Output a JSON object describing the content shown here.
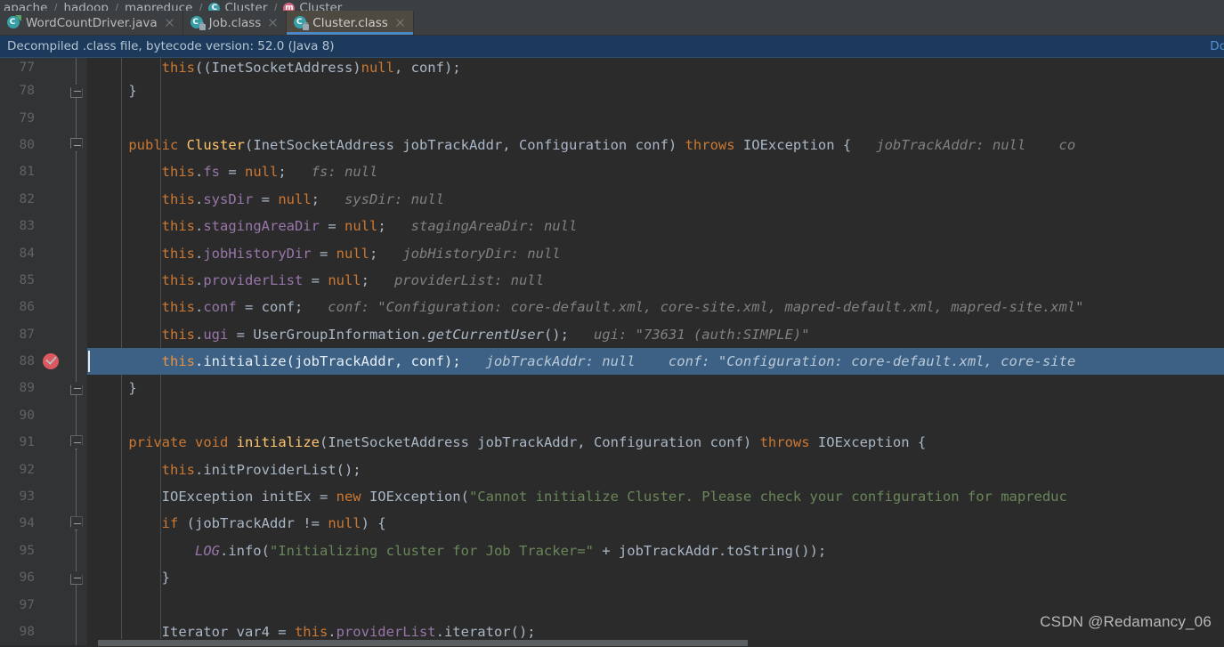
{
  "breadcrumb": {
    "items": [
      {
        "label": "apache",
        "icon": null
      },
      {
        "label": "hadoop",
        "icon": null
      },
      {
        "label": "mapreduce",
        "icon": null
      },
      {
        "label": "Cluster",
        "icon": "class-icon"
      },
      {
        "label": "Cluster",
        "icon": "method-icon"
      }
    ],
    "separator": "/"
  },
  "tabs": [
    {
      "label": "WordCountDriver.java",
      "icon": "java-source-icon",
      "active": false,
      "close": "close-icon"
    },
    {
      "label": "Job.class",
      "icon": "java-class-locked-icon",
      "active": false,
      "close": "close-icon"
    },
    {
      "label": "Cluster.class",
      "icon": "java-class-locked-icon",
      "active": true,
      "close": "close-icon"
    }
  ],
  "notification": {
    "message": "Decompiled .class file, bytecode version: 52.0 (Java 8)",
    "action_label": "Dow"
  },
  "editor": {
    "caret_line": 88,
    "breakpoint_line": 88,
    "lines": [
      {
        "num": "77",
        "clipped": true,
        "fold": null,
        "tokens": [
          {
            "t": "        ",
            "c": "plain"
          },
          {
            "t": "this",
            "c": "kw"
          },
          {
            "t": "((InetSocketAddress)",
            "c": "plain"
          },
          {
            "t": "null",
            "c": "kw"
          },
          {
            "t": ", conf);",
            "c": "plain"
          }
        ]
      },
      {
        "num": "78",
        "fold": "close",
        "tokens": [
          {
            "t": "    ",
            "c": "plain"
          },
          {
            "t": "}",
            "c": "brace"
          }
        ]
      },
      {
        "num": "79",
        "fold": null,
        "tokens": []
      },
      {
        "num": "80",
        "fold": "open",
        "tokens": [
          {
            "t": "    ",
            "c": "plain"
          },
          {
            "t": "public",
            "c": "kw"
          },
          {
            "t": " ",
            "c": "plain"
          },
          {
            "t": "Cluster",
            "c": "mdecl"
          },
          {
            "t": "(InetSocketAddress jobTrackAddr, Configuration conf) ",
            "c": "plain"
          },
          {
            "t": "throws",
            "c": "kw"
          },
          {
            "t": " IOException {",
            "c": "plain"
          },
          {
            "t": "   jobTrackAddr: null",
            "c": "hintv"
          },
          {
            "t": "    co",
            "c": "hintv"
          }
        ]
      },
      {
        "num": "81",
        "fold": null,
        "tokens": [
          {
            "t": "        ",
            "c": "plain"
          },
          {
            "t": "this",
            "c": "kw"
          },
          {
            "t": ".",
            "c": "plain"
          },
          {
            "t": "fs",
            "c": "fld"
          },
          {
            "t": " = ",
            "c": "plain"
          },
          {
            "t": "null",
            "c": "kw"
          },
          {
            "t": ";",
            "c": "plain"
          },
          {
            "t": "   fs: null",
            "c": "hintv"
          }
        ]
      },
      {
        "num": "82",
        "fold": null,
        "tokens": [
          {
            "t": "        ",
            "c": "plain"
          },
          {
            "t": "this",
            "c": "kw"
          },
          {
            "t": ".",
            "c": "plain"
          },
          {
            "t": "sysDir",
            "c": "fld"
          },
          {
            "t": " = ",
            "c": "plain"
          },
          {
            "t": "null",
            "c": "kw"
          },
          {
            "t": ";",
            "c": "plain"
          },
          {
            "t": "   sysDir: null",
            "c": "hintv"
          }
        ]
      },
      {
        "num": "83",
        "fold": null,
        "tokens": [
          {
            "t": "        ",
            "c": "plain"
          },
          {
            "t": "this",
            "c": "kw"
          },
          {
            "t": ".",
            "c": "plain"
          },
          {
            "t": "stagingAreaDir",
            "c": "fld"
          },
          {
            "t": " = ",
            "c": "plain"
          },
          {
            "t": "null",
            "c": "kw"
          },
          {
            "t": ";",
            "c": "plain"
          },
          {
            "t": "   stagingAreaDir: null",
            "c": "hintv"
          }
        ]
      },
      {
        "num": "84",
        "fold": null,
        "tokens": [
          {
            "t": "        ",
            "c": "plain"
          },
          {
            "t": "this",
            "c": "kw"
          },
          {
            "t": ".",
            "c": "plain"
          },
          {
            "t": "jobHistoryDir",
            "c": "fld"
          },
          {
            "t": " = ",
            "c": "plain"
          },
          {
            "t": "null",
            "c": "kw"
          },
          {
            "t": ";",
            "c": "plain"
          },
          {
            "t": "   jobHistoryDir: null",
            "c": "hintv"
          }
        ]
      },
      {
        "num": "85",
        "fold": null,
        "tokens": [
          {
            "t": "        ",
            "c": "plain"
          },
          {
            "t": "this",
            "c": "kw"
          },
          {
            "t": ".",
            "c": "plain"
          },
          {
            "t": "providerList",
            "c": "fld"
          },
          {
            "t": " = ",
            "c": "plain"
          },
          {
            "t": "null",
            "c": "kw"
          },
          {
            "t": ";",
            "c": "plain"
          },
          {
            "t": "   providerList: null",
            "c": "hintv"
          }
        ]
      },
      {
        "num": "86",
        "fold": null,
        "tokens": [
          {
            "t": "        ",
            "c": "plain"
          },
          {
            "t": "this",
            "c": "kw"
          },
          {
            "t": ".",
            "c": "plain"
          },
          {
            "t": "conf",
            "c": "fld"
          },
          {
            "t": " = conf;",
            "c": "plain"
          },
          {
            "t": "   conf: \"Configuration: core-default.xml, core-site.xml, mapred-default.xml, mapred-site.xml\"",
            "c": "hintv"
          }
        ]
      },
      {
        "num": "87",
        "fold": null,
        "tokens": [
          {
            "t": "        ",
            "c": "plain"
          },
          {
            "t": "this",
            "c": "kw"
          },
          {
            "t": ".",
            "c": "plain"
          },
          {
            "t": "ugi",
            "c": "fld"
          },
          {
            "t": " = UserGroupInformation.",
            "c": "plain"
          },
          {
            "t": "getCurrentUser",
            "c": "mcall"
          },
          {
            "t": "();",
            "c": "plain"
          },
          {
            "t": "   ugi: \"73631 (auth:SIMPLE)\"",
            "c": "hintv"
          }
        ]
      },
      {
        "num": "88",
        "fold": null,
        "highlight": true,
        "breakpoint": true,
        "caret": true,
        "tokens": [
          {
            "t": "        ",
            "c": "plain"
          },
          {
            "t": "this",
            "c": "kw"
          },
          {
            "t": ".initialize(jobTrackAddr, conf);",
            "c": "plain"
          },
          {
            "t": "   jobTrackAddr: null",
            "c": "hintb"
          },
          {
            "t": "    conf: \"Configuration: core-default.xml, core-site",
            "c": "hintb"
          }
        ]
      },
      {
        "num": "89",
        "fold": "close",
        "tokens": [
          {
            "t": "    ",
            "c": "plain"
          },
          {
            "t": "}",
            "c": "brace"
          }
        ]
      },
      {
        "num": "90",
        "fold": null,
        "tokens": []
      },
      {
        "num": "91",
        "fold": "open",
        "tokens": [
          {
            "t": "    ",
            "c": "plain"
          },
          {
            "t": "private",
            "c": "kw"
          },
          {
            "t": " ",
            "c": "plain"
          },
          {
            "t": "void",
            "c": "kw"
          },
          {
            "t": " ",
            "c": "plain"
          },
          {
            "t": "initialize",
            "c": "mdecl"
          },
          {
            "t": "(InetSocketAddress jobTrackAddr, Configuration conf) ",
            "c": "plain"
          },
          {
            "t": "throws",
            "c": "kw"
          },
          {
            "t": " IOException {",
            "c": "plain"
          }
        ]
      },
      {
        "num": "92",
        "fold": null,
        "tokens": [
          {
            "t": "        ",
            "c": "plain"
          },
          {
            "t": "this",
            "c": "kw"
          },
          {
            "t": ".initProviderList();",
            "c": "plain"
          }
        ]
      },
      {
        "num": "93",
        "fold": null,
        "tokens": [
          {
            "t": "        IOException initEx = ",
            "c": "plain"
          },
          {
            "t": "new",
            "c": "kw"
          },
          {
            "t": " IOException(",
            "c": "plain"
          },
          {
            "t": "\"Cannot initialize Cluster. Please check your configuration for mapreduc",
            "c": "str"
          }
        ]
      },
      {
        "num": "94",
        "fold": "open",
        "tokens": [
          {
            "t": "        ",
            "c": "plain"
          },
          {
            "t": "if",
            "c": "kw"
          },
          {
            "t": " (jobTrackAddr != ",
            "c": "plain"
          },
          {
            "t": "null",
            "c": "kw"
          },
          {
            "t": ") {",
            "c": "plain"
          }
        ]
      },
      {
        "num": "95",
        "fold": null,
        "tokens": [
          {
            "t": "            ",
            "c": "plain"
          },
          {
            "t": "LOG",
            "c": "sfld"
          },
          {
            "t": ".info(",
            "c": "plain"
          },
          {
            "t": "\"Initializing cluster for Job Tracker=\"",
            "c": "str"
          },
          {
            "t": " + jobTrackAddr.toString());",
            "c": "plain"
          }
        ]
      },
      {
        "num": "96",
        "fold": "close",
        "tokens": [
          {
            "t": "        ",
            "c": "plain"
          },
          {
            "t": "}",
            "c": "brace"
          }
        ]
      },
      {
        "num": "97",
        "fold": null,
        "tokens": []
      },
      {
        "num": "98",
        "fold": null,
        "tokens": [
          {
            "t": "        Iterator var4 = ",
            "c": "plain"
          },
          {
            "t": "this",
            "c": "kw"
          },
          {
            "t": ".",
            "c": "plain"
          },
          {
            "t": "providerList",
            "c": "fld"
          },
          {
            "t": ".iterator();",
            "c": "plain"
          }
        ]
      }
    ]
  },
  "watermark": "CSDN @Redamancy_06",
  "colors": {
    "editor_bg": "#2b2b2b",
    "gutter_bg": "#313335",
    "chrome_bg": "#3c3f41",
    "active_tab_bg": "#4e4a41",
    "tab_underline": "#4a88c7",
    "notification_bg": "#1b3a5c",
    "selection_bg": "#3d6185",
    "breakpoint": "#db5860",
    "keyword": "#cc7832",
    "string": "#6a8759",
    "field": "#9876aa",
    "method": "#ffc66d",
    "text": "#a9b7c6",
    "hint": "#808080",
    "link": "#5891d4"
  }
}
